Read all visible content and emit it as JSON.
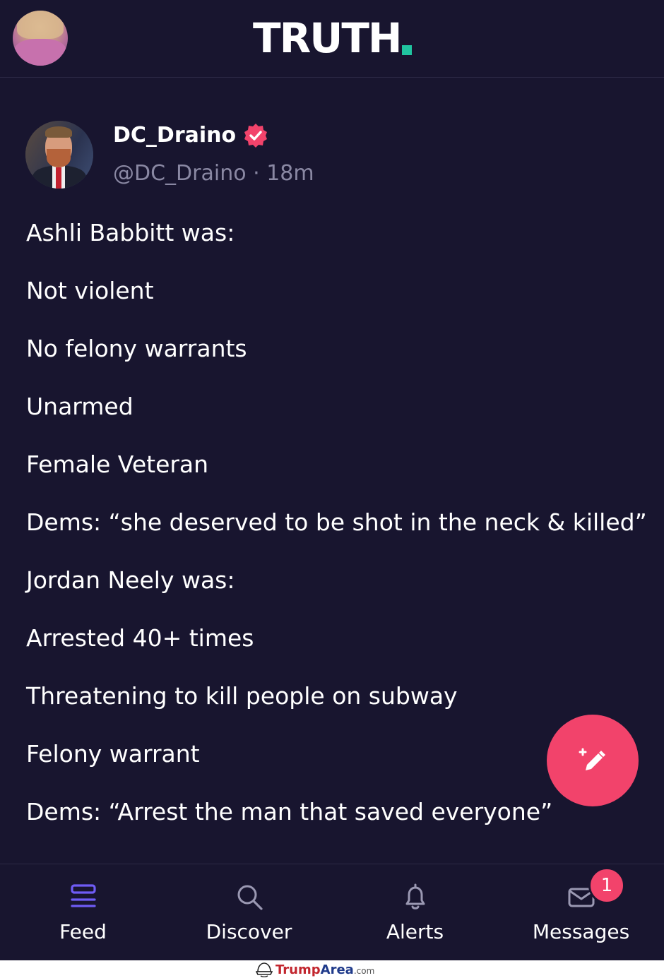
{
  "header": {
    "logo_text": "TRUTH",
    "logo_accent": "#20c4a0"
  },
  "post": {
    "display_name": "DC_Draino",
    "verified": true,
    "handle": "@DC_Draino",
    "separator": "·",
    "time": "18m",
    "lines": [
      "Ashli Babbitt was:",
      "Not violent",
      "No felony warrants",
      "Unarmed",
      "Female Veteran",
      "Dems: “she deserved to be shot in the neck & killed”",
      "Jordan Neely was:",
      "Arrested 40+ times",
      "Threatening to kill people on subway",
      "Felony warrant",
      "Dems: “Arrest the man that saved everyone”"
    ]
  },
  "nav": {
    "items": [
      {
        "label": "Feed",
        "icon": "feed-icon"
      },
      {
        "label": "Discover",
        "icon": "search-icon"
      },
      {
        "label": "Alerts",
        "icon": "bell-icon"
      },
      {
        "label": "Messages",
        "icon": "mail-icon"
      }
    ],
    "messages_badge": "1"
  },
  "watermark": {
    "part1": "Trump",
    "part2": "Area",
    "part3": ".com"
  },
  "colors": {
    "background": "#18152f",
    "accent_pink": "#f2436b",
    "feed_active": "#6f5cf5",
    "muted_text": "#8a88a3"
  }
}
